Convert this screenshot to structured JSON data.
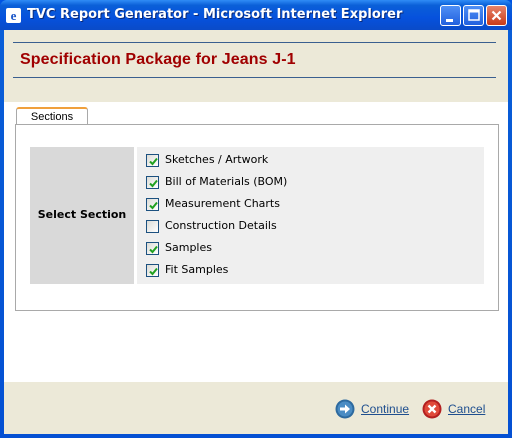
{
  "window": {
    "title": "TVC Report Generator - Microsoft Internet Explorer",
    "controls": [
      "minimize",
      "maximize",
      "close"
    ]
  },
  "page": {
    "title": "Specification Package for Jeans J-1"
  },
  "tabs": [
    {
      "label": "Sections",
      "active": true
    }
  ],
  "section_selector": {
    "label": "Select Section",
    "options": [
      {
        "label": "Sketches / Artwork",
        "checked": true
      },
      {
        "label": "Bill of Materials (BOM)",
        "checked": true
      },
      {
        "label": "Measurement Charts",
        "checked": true
      },
      {
        "label": "Construction Details",
        "checked": false
      },
      {
        "label": "Samples",
        "checked": true
      },
      {
        "label": "Fit Samples",
        "checked": true
      }
    ]
  },
  "actions": {
    "continue_label": "Continue",
    "cancel_label": "Cancel"
  },
  "colors": {
    "title_red": "#a00000",
    "link_blue": "#1f4f8f",
    "tab_accent": "#f0a03c"
  }
}
